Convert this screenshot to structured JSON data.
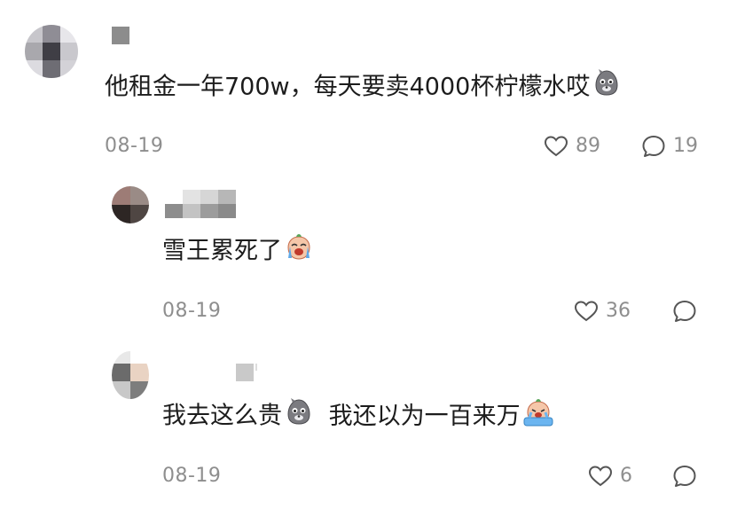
{
  "comments": [
    {
      "text": "他租金一年700w，每天要卖4000杯柠檬水哎",
      "emoji": "dog-emoji",
      "date": "08-19",
      "likes": "89",
      "replies": "19"
    },
    {
      "text": "雪王累死了",
      "emoji": "crying-emoji",
      "date": "08-19",
      "likes": "36"
    },
    {
      "text": "我去这么贵",
      "emoji": "dog-emoji",
      "text2": "我还以为一百来万",
      "emoji2": "sobbing-emoji",
      "date": "08-19",
      "likes": "6"
    }
  ],
  "colors": {
    "meta_gray": "#8e8e8e",
    "icon_gray": "#555555"
  }
}
